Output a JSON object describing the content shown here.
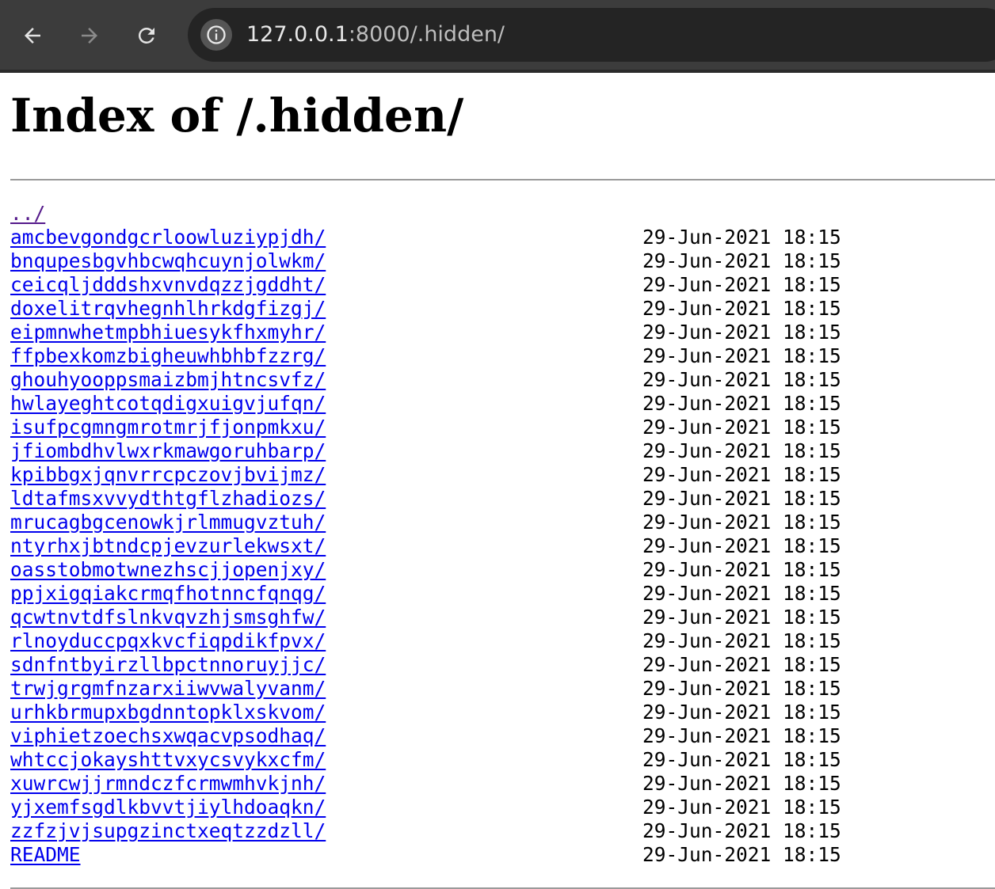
{
  "browser": {
    "url_host": "127.0.0.1",
    "url_path": ":8000/.hidden/"
  },
  "page": {
    "title": "Index of /.hidden/",
    "parent_link": "../",
    "entries": [
      {
        "name": "amcbevgondgcrloowluziypjdh/",
        "date": "29-Jun-2021 18:15"
      },
      {
        "name": "bnqupesbgvhbcwqhcuynjolwkm/",
        "date": "29-Jun-2021 18:15"
      },
      {
        "name": "ceicqljdddshxvnvdqzzjgddht/",
        "date": "29-Jun-2021 18:15"
      },
      {
        "name": "doxelitrqvhegnhlhrkdgfizgj/",
        "date": "29-Jun-2021 18:15"
      },
      {
        "name": "eipmnwhetmpbhiuesykfhxmyhr/",
        "date": "29-Jun-2021 18:15"
      },
      {
        "name": "ffpbexkomzbigheuwhbhbfzzrg/",
        "date": "29-Jun-2021 18:15"
      },
      {
        "name": "ghouhyooppsmaizbmjhtncsvfz/",
        "date": "29-Jun-2021 18:15"
      },
      {
        "name": "hwlayeghtcotqdigxuigvjufqn/",
        "date": "29-Jun-2021 18:15"
      },
      {
        "name": "isufpcgmngmrotmrjfjonpmkxu/",
        "date": "29-Jun-2021 18:15"
      },
      {
        "name": "jfiombdhvlwxrkmawgoruhbarp/",
        "date": "29-Jun-2021 18:15"
      },
      {
        "name": "kpibbgxjqnvrrcpczovjbvijmz/",
        "date": "29-Jun-2021 18:15"
      },
      {
        "name": "ldtafmsxvvydthtgflzhadiozs/",
        "date": "29-Jun-2021 18:15"
      },
      {
        "name": "mrucagbgcenowkjrlmmugvztuh/",
        "date": "29-Jun-2021 18:15"
      },
      {
        "name": "ntyrhxjbtndcpjevzurlekwsxt/",
        "date": "29-Jun-2021 18:15"
      },
      {
        "name": "oasstobmotwnezhscjjopenjxy/",
        "date": "29-Jun-2021 18:15"
      },
      {
        "name": "ppjxigqiakcrmqfhotnncfqnqg/",
        "date": "29-Jun-2021 18:15"
      },
      {
        "name": "qcwtnvtdfslnkvqvzhjsmsghfw/",
        "date": "29-Jun-2021 18:15"
      },
      {
        "name": "rlnoyduccpqxkvcfiqpdikfpvx/",
        "date": "29-Jun-2021 18:15"
      },
      {
        "name": "sdnfntbyirzllbpctnnoruyjjc/",
        "date": "29-Jun-2021 18:15"
      },
      {
        "name": "trwjgrgmfnzarxiiwvwalyvanm/",
        "date": "29-Jun-2021 18:15"
      },
      {
        "name": "urhkbrmupxbgdnntopklxskvom/",
        "date": "29-Jun-2021 18:15"
      },
      {
        "name": "viphietzoechsxwqacvpsodhaq/",
        "date": "29-Jun-2021 18:15"
      },
      {
        "name": "whtccjokayshttvxycsvykxcfm/",
        "date": "29-Jun-2021 18:15"
      },
      {
        "name": "xuwrcwjjrmndczfcrmwmhvkjnh/",
        "date": "29-Jun-2021 18:15"
      },
      {
        "name": "yjxemfsgdlkbvvtjiylhdoaqkn/",
        "date": "29-Jun-2021 18:15"
      },
      {
        "name": "zzfzjvjsupgzinctxeqtzzdzll/",
        "date": "29-Jun-2021 18:15"
      },
      {
        "name": "README",
        "date": "29-Jun-2021 18:15"
      }
    ]
  },
  "icons": {
    "back": "arrow-left-icon",
    "forward": "arrow-right-icon",
    "reload": "reload-icon",
    "site_info": "info-icon"
  },
  "colors": {
    "toolbar_bg": "#3c3c3c",
    "omnibox_bg": "#242424",
    "link": "#0000ee",
    "visited_link": "#551a8b"
  }
}
